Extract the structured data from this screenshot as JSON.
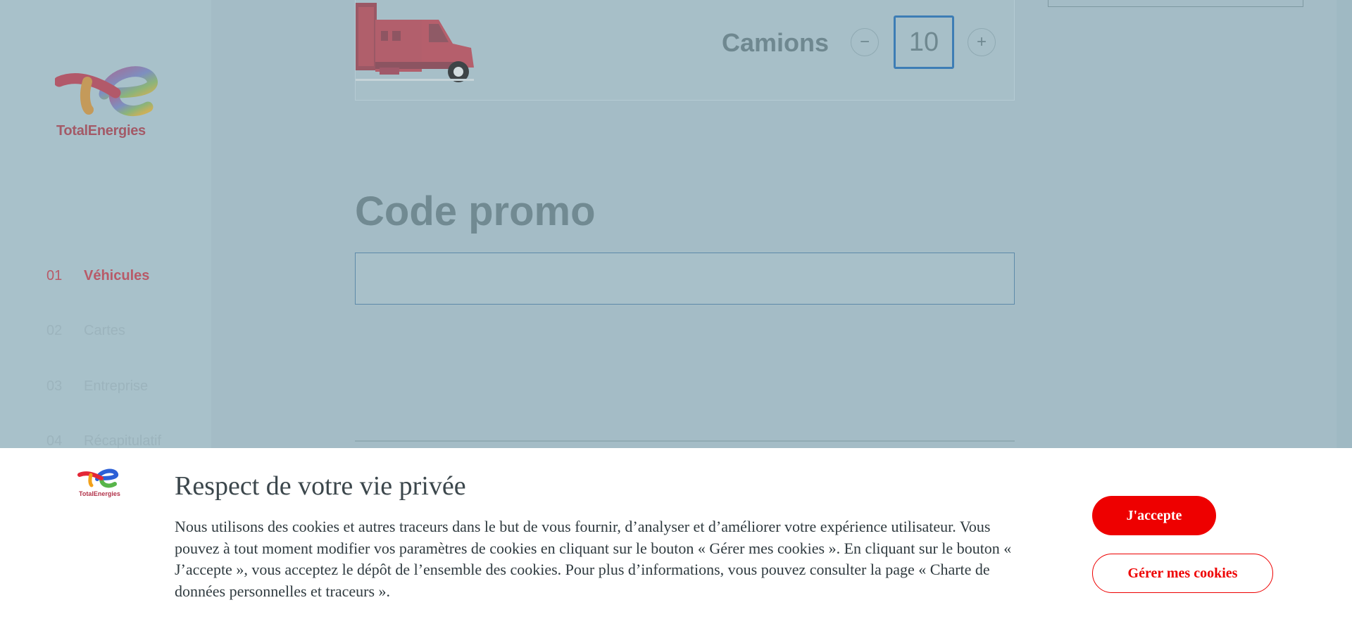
{
  "brand": {
    "logo_text": "TotalEnergies",
    "accent_color": "#ee0000"
  },
  "steps": [
    {
      "number": "01",
      "label": "Véhicules",
      "active": true
    },
    {
      "number": "02",
      "label": "Cartes",
      "active": false
    },
    {
      "number": "03",
      "label": "Entreprise",
      "active": false
    },
    {
      "number": "04",
      "label": "Récapitulatif",
      "active": false
    }
  ],
  "vehicle": {
    "label": "Camions",
    "quantity": "10",
    "decrement_symbol": "−",
    "increment_symbol": "+",
    "icon": "truck-icon"
  },
  "promo": {
    "title": "Code promo",
    "input_value": ""
  },
  "cookie_banner": {
    "logo_text": "TotalEnergies",
    "title": "Respect de votre vie privée",
    "text": "Nous utilisons des cookies et autres traceurs dans le but de vous fournir, d’analyser et d’améliorer votre expérience utilisateur. Vous pouvez à tout moment modifier vos paramètres de cookies en cliquant sur le bouton « Gérer mes cookies ». En cliquant sur le bouton « J’accepte », vous acceptez le dépôt de l’ensemble des cookies. Pour plus d’informations, vous pouvez consulter la page « Charte de données personnelles et traceurs ».",
    "accept_label": "J'accepte",
    "manage_label": "Gérer mes cookies"
  }
}
